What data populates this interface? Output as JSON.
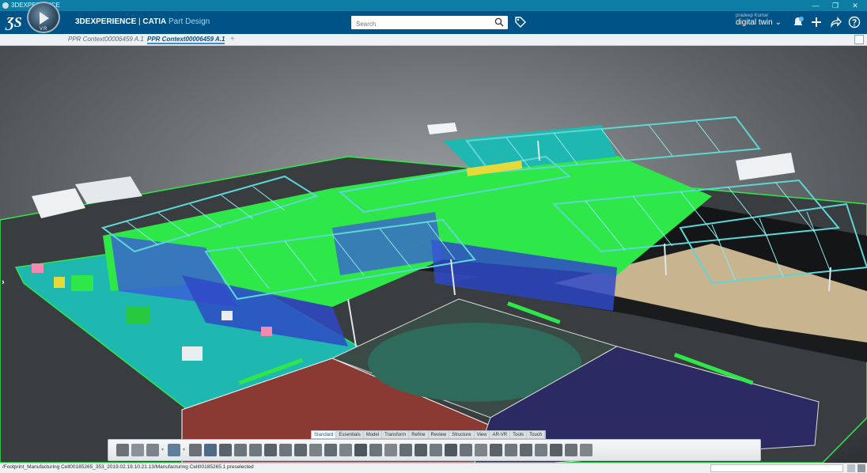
{
  "window": {
    "title": "3DEXPERIENCE",
    "minimize": "—",
    "restore": "❐",
    "close": "✕"
  },
  "header": {
    "brand_bold": "3DEXPERIENCE",
    "brand_sep": " | ",
    "brand_app": "CATIA",
    "brand_sub": "Part Design",
    "compass_label": "V.R",
    "search_placeholder": "Search",
    "user_name": "pradeep Kumar",
    "user_context": "digital twin ⌄"
  },
  "tabs": [
    {
      "label": "PPR Context00006459 A.1"
    },
    {
      "label": "PPR Context00006459 A.1"
    }
  ],
  "tab_add": "+",
  "command_tabs": [
    "Standard",
    "Essentials",
    "Model",
    "Transform",
    "Refine",
    "Review",
    "Structure",
    "View",
    "AR-VR",
    "Tools",
    "Touch"
  ],
  "status": {
    "text": "/Footprint_Manufacturing Cell00185265_353_2019.02.19.10.21.13/Manufacturing Cell00185265.1 preselected"
  },
  "colors": {
    "titlebar": "#0d7da3",
    "header": "#005386",
    "accent": "#3a8fd0",
    "floor_cyan": "#1fb8b0",
    "floor_green": "#2ee84a",
    "floor_red": "#8b3a33",
    "floor_navy": "#2c2a63",
    "floor_sand": "#c8b48e"
  }
}
